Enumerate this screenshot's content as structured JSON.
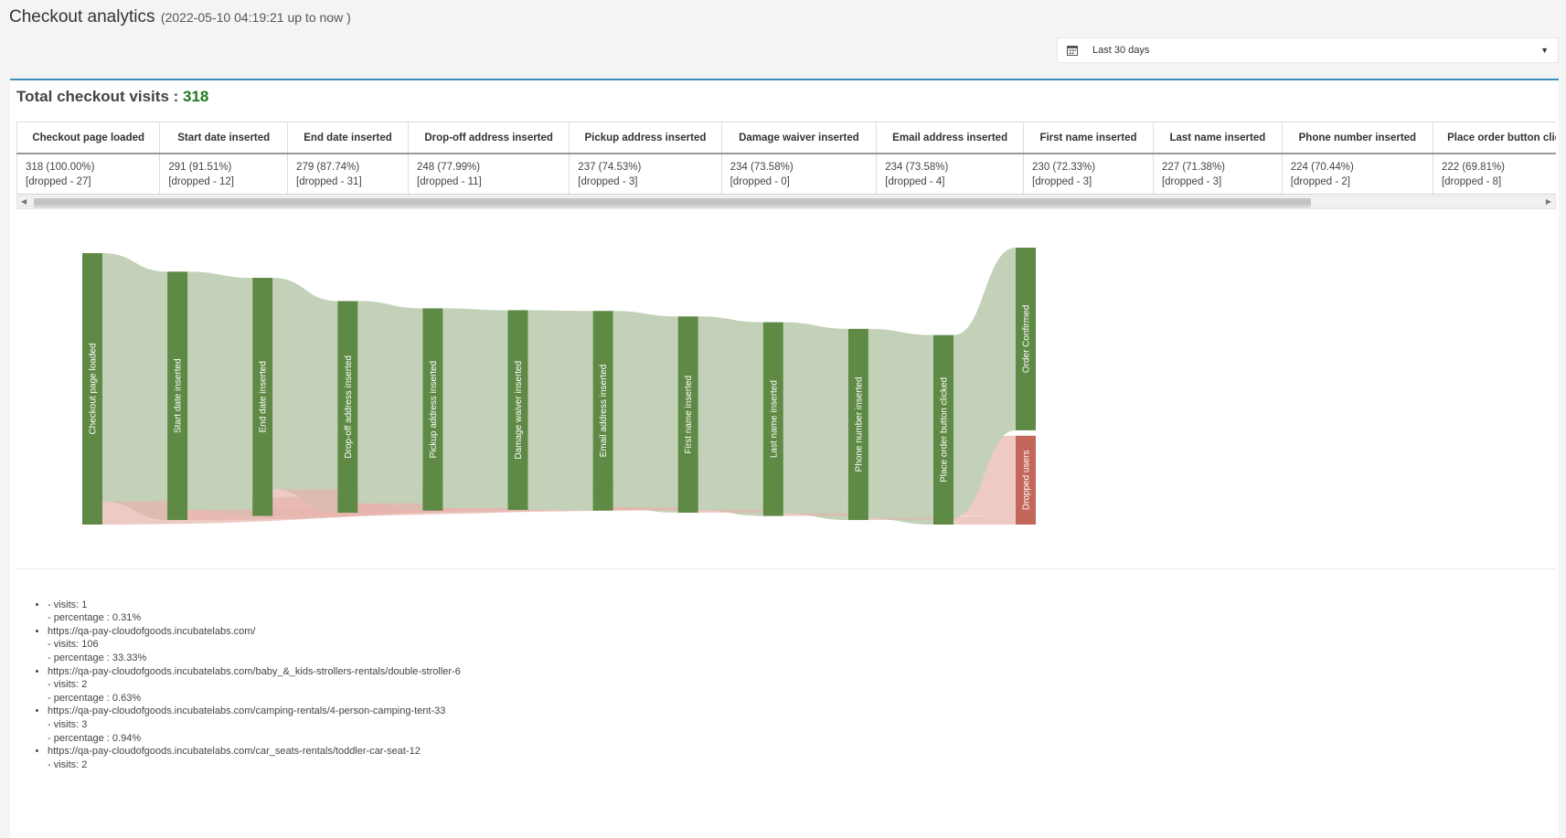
{
  "header": {
    "title": "Checkout analytics",
    "subtitle": "(2022-05-10 04:19:21 up to now )"
  },
  "daterange": {
    "label": "Last 30 days",
    "icon": "calendar-icon"
  },
  "total": {
    "label": "Total checkout visits :",
    "value": "318"
  },
  "table": {
    "columns": [
      {
        "header": "Checkout page loaded",
        "value": "318 (100.00%)",
        "dropped": "[dropped - 27]"
      },
      {
        "header": "Start date inserted",
        "value": "291 (91.51%)",
        "dropped": "[dropped - 12]"
      },
      {
        "header": "End date inserted",
        "value": "279 (87.74%)",
        "dropped": "[dropped - 31]"
      },
      {
        "header": "Drop-off address inserted",
        "value": "248 (77.99%)",
        "dropped": "[dropped - 11]"
      },
      {
        "header": "Pickup address inserted",
        "value": "237 (74.53%)",
        "dropped": "[dropped - 3]"
      },
      {
        "header": "Damage waiver inserted",
        "value": "234 (73.58%)",
        "dropped": "[dropped - 0]"
      },
      {
        "header": "Email address inserted",
        "value": "234 (73.58%)",
        "dropped": "[dropped - 4]"
      },
      {
        "header": "First name inserted",
        "value": "230 (72.33%)",
        "dropped": "[dropped - 3]"
      },
      {
        "header": "Last name inserted",
        "value": "227 (71.38%)",
        "dropped": "[dropped - 3]"
      },
      {
        "header": "Phone number inserted",
        "value": "224 (70.44%)",
        "dropped": "[dropped - 2]"
      },
      {
        "header": "Place order button clicke",
        "value": "222 (69.81%)",
        "dropped": "[dropped - 8]"
      }
    ]
  },
  "sankey": {
    "colors": {
      "node": "#5e8a45",
      "flow": "#c2d1b8",
      "drop_node": "#c4675b",
      "drop_flow": "#e7b3ac"
    },
    "nodes": [
      {
        "label": "Checkout page loaded",
        "value": 318
      },
      {
        "label": "Start date inserted",
        "value": 291
      },
      {
        "label": "End date inserted",
        "value": 279
      },
      {
        "label": "Drop-off address inserted",
        "value": 248
      },
      {
        "label": "Pickup address inserted",
        "value": 237
      },
      {
        "label": "Damage waiver inserted",
        "value": 234
      },
      {
        "label": "Email address inserted",
        "value": 234
      },
      {
        "label": "First name inserted",
        "value": 230
      },
      {
        "label": "Last name inserted",
        "value": 227
      },
      {
        "label": "Phone number inserted",
        "value": 224
      },
      {
        "label": "Place order button clicked",
        "value": 222
      }
    ],
    "confirmed": {
      "label": "Order Confirmed",
      "value": 214
    },
    "dropped": {
      "label": "Dropped users",
      "value": 104
    },
    "drops": [
      27,
      12,
      31,
      11,
      3,
      0,
      4,
      3,
      3,
      2,
      8
    ]
  },
  "urls": [
    {
      "url": "",
      "visits": "- visits: 1",
      "percentage": "- percentage : 0.31%"
    },
    {
      "url": "https://qa-pay-cloudofgoods.incubatelabs.com/",
      "visits": "- visits: 106",
      "percentage": "- percentage : 33.33%"
    },
    {
      "url": "https://qa-pay-cloudofgoods.incubatelabs.com/baby_&_kids-strollers-rentals/double-stroller-6",
      "visits": "- visits: 2",
      "percentage": "- percentage : 0.63%"
    },
    {
      "url": "https://qa-pay-cloudofgoods.incubatelabs.com/camping-rentals/4-person-camping-tent-33",
      "visits": "- visits: 3",
      "percentage": "- percentage : 0.94%"
    },
    {
      "url": "https://qa-pay-cloudofgoods.incubatelabs.com/car_seats-rentals/toddler-car-seat-12",
      "visits": "- visits: 2",
      "percentage": ""
    }
  ]
}
